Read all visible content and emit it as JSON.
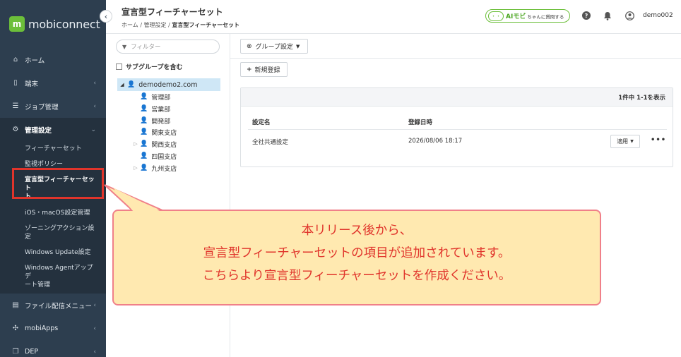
{
  "app": {
    "logo_text": "mobiconnect",
    "logo_letter": "m"
  },
  "sidebar": {
    "items": [
      {
        "label": "ホーム",
        "icon": "home-icon"
      },
      {
        "label": "端末",
        "icon": "device-icon"
      },
      {
        "label": "ジョブ管理",
        "icon": "job-icon"
      },
      {
        "label": "管理設定",
        "icon": "gear-icon"
      },
      {
        "label": "ファイル配信メニュー",
        "icon": "file-icon"
      },
      {
        "label": "mobiApps",
        "icon": "apps-icon"
      },
      {
        "label": "DEP",
        "icon": "copy-icon"
      }
    ],
    "subitems": [
      "フィーチャーセット",
      "監視ポリシー",
      "宣言型フィーチャーセット",
      "ト",
      "iOS・macOS設定管理",
      "ゾーニングアクション設",
      "定",
      "Windows Update設定",
      "Windows Agentアップデ",
      "ート管理"
    ]
  },
  "header": {
    "title": "宣言型フィーチャーセット",
    "breadcrumb": [
      "ホーム",
      "管理設定",
      "宣言型フィーチャーセット"
    ],
    "breadcrumb_sep": "/",
    "ai_label": "AIモビ",
    "ai_suffix": "ちゃんに質問する",
    "ai_face": "・・",
    "user": "demo002"
  },
  "tree": {
    "filter_placeholder": "フィルター",
    "subgroup_label": "サブグループを含む",
    "root": "demodemo2.com",
    "nodes": [
      {
        "label": "管理部",
        "expandable": false
      },
      {
        "label": "営業部",
        "expandable": false
      },
      {
        "label": "開発部",
        "expandable": false
      },
      {
        "label": "関東支店",
        "expandable": false
      },
      {
        "label": "関西支店",
        "expandable": true
      },
      {
        "label": "四国支店",
        "expandable": false
      },
      {
        "label": "九州支店",
        "expandable": true
      }
    ]
  },
  "main": {
    "group_settings": "グループ設定",
    "new_register": "新規登録",
    "count_text": "1件中 1-1を表示",
    "columns": [
      "設定名",
      "登録日時"
    ],
    "rows": [
      {
        "name": "全社共通設定",
        "date": "2026/08/06 18:17"
      }
    ],
    "apply_label": "適用",
    "more_label": "•••"
  },
  "callout": {
    "lines": [
      "本リリース後から、",
      "宣言型フィーチャーセットの項目が追加されています。",
      "こちらより宣言型フィーチャーセットを作成ください。"
    ],
    "colors": {
      "text": "#e0342b",
      "fill": "#ffe9b0",
      "border": "#f08089",
      "highlight": "#e0342b"
    }
  }
}
